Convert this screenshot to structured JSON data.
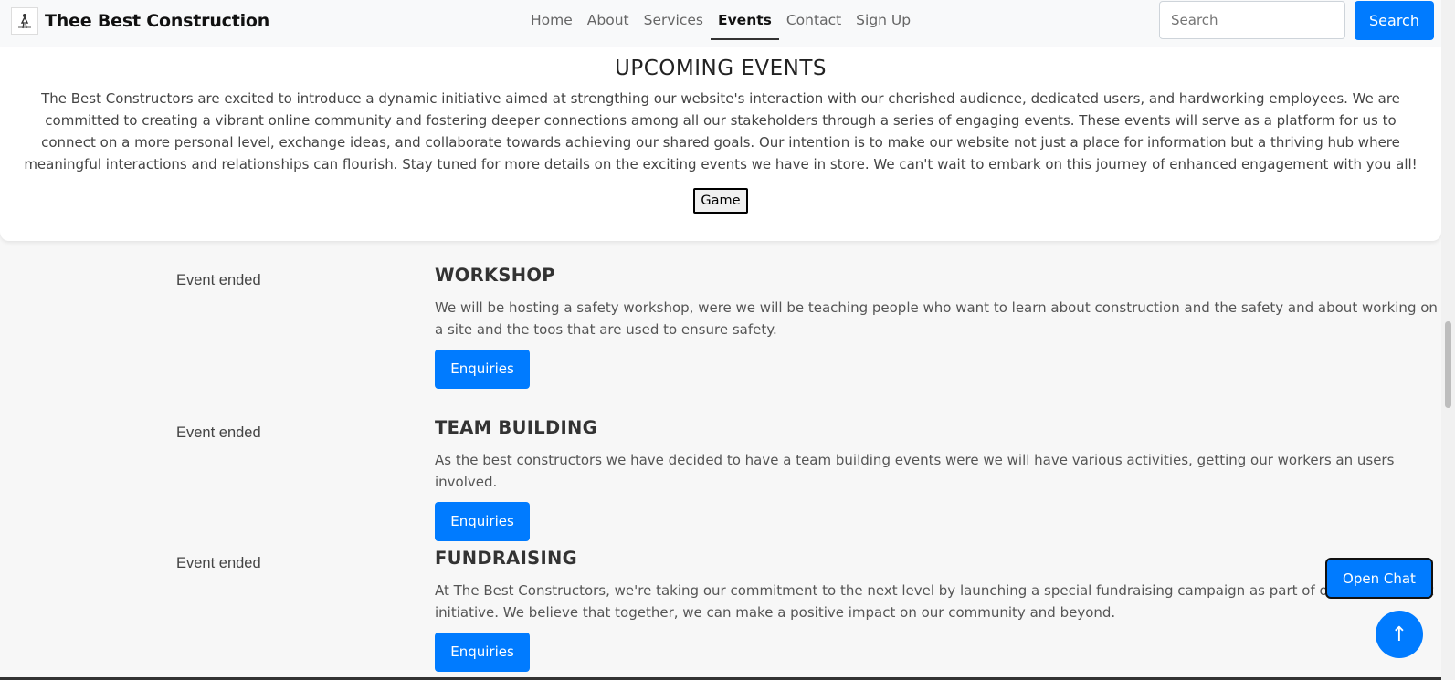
{
  "brand": {
    "name": "Thee Best Construction"
  },
  "nav": {
    "items": [
      {
        "label": "Home"
      },
      {
        "label": "About"
      },
      {
        "label": "Services"
      },
      {
        "label": "Events"
      },
      {
        "label": "Contact"
      },
      {
        "label": "Sign Up"
      }
    ],
    "active": "Events"
  },
  "search": {
    "placeholder": "Search",
    "button_label": "Search"
  },
  "hero": {
    "title": "UPCOMING EVENTS",
    "text": "The Best Constructors are excited to introduce a dynamic initiative aimed at strengthing our website's interaction with our cherished audience, dedicated users, and hardworking employees. We are committed to creating a vibrant online community and fostering deeper connections among all our stakeholders through a series of engaging events. These events will serve as a platform for us to connect on a more personal level, exchange ideas, and collaborate towards achieving our shared goals. Our intention is to make our website not just a place for information but a thriving hub where meaningful interactions and relationships can flourish. Stay tuned for more details on the exciting events we have in store. We can't wait to embark on this journey of enhanced engagement with you all!",
    "game_label": "Game"
  },
  "events": [
    {
      "status": "Event ended",
      "title": "WORKSHOP",
      "description": "We will be hosting a safety workshop, were we will be teaching people who want to learn about construction and the safety and about working on a site and the toos that are used to ensure safety.",
      "button_label": "Enquiries"
    },
    {
      "status": "Event ended",
      "title": "TEAM BUILDING",
      "description": "As the best constructors we have decided to have a team building events were we will have various activities, getting our workers an users involved.",
      "button_label": "Enquiries"
    },
    {
      "status": "Event ended",
      "title": "FUNDRAISING",
      "description": "At The Best Constructors, we're taking our commitment to the next level by launching a special fundraising campaign as part of our engagement initiative. We believe that together, we can make a positive impact on our community and beyond.",
      "button_label": "Enquiries"
    }
  ],
  "chat": {
    "label": "Open Chat"
  },
  "scroll_top": {
    "icon": "arrow-up-icon",
    "glyph": "↑"
  },
  "colors": {
    "primary": "#007bff",
    "navbar_bg": "#f8f9fa",
    "page_bg": "#f7f7f7"
  }
}
